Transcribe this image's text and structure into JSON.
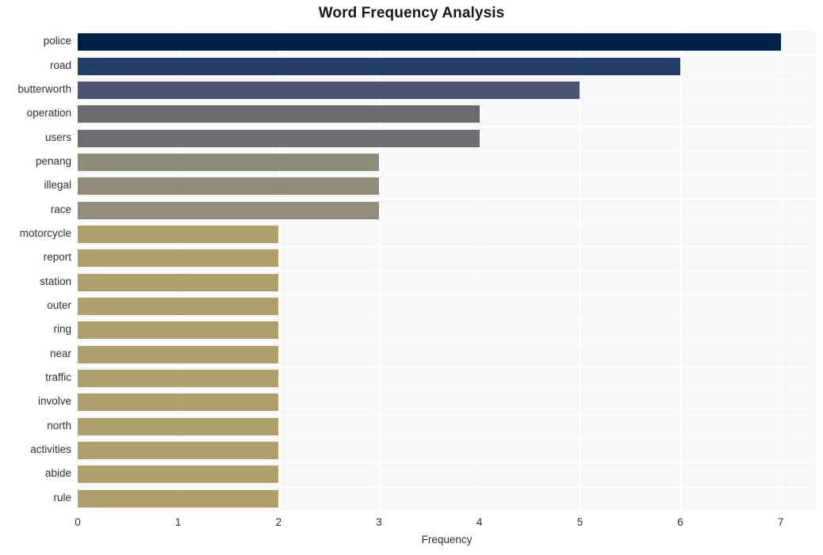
{
  "chart_data": {
    "type": "bar",
    "orientation": "horizontal",
    "title": "Word Frequency Analysis",
    "xlabel": "Frequency",
    "ylabel": "",
    "xlim": [
      0,
      7.35
    ],
    "ylim": [
      0,
      20
    ],
    "grid": true,
    "legend": false,
    "xticks": [
      0,
      1,
      2,
      3,
      4,
      5,
      6,
      7
    ],
    "xtick_labels": [
      "0",
      "1",
      "2",
      "3",
      "4",
      "5",
      "6",
      "7"
    ],
    "categories": [
      "police",
      "road",
      "butterworth",
      "operation",
      "users",
      "penang",
      "illegal",
      "race",
      "motorcycle",
      "report",
      "station",
      "outer",
      "ring",
      "near",
      "traffic",
      "involve",
      "north",
      "activities",
      "abide",
      "rule"
    ],
    "values": [
      7,
      6,
      5,
      4,
      4,
      3,
      3,
      3,
      2,
      2,
      2,
      2,
      2,
      2,
      2,
      2,
      2,
      2,
      2,
      2
    ],
    "bar_colors": [
      "#002147",
      "#253D6B",
      "#4C5470",
      "#6B6C70",
      "#6D6E73",
      "#8F8B79",
      "#918C78",
      "#918D7A",
      "#ADA06C",
      "#ADA06C",
      "#ADA06C",
      "#ADA06C",
      "#ADA06C",
      "#ADA06C",
      "#ADA06C",
      "#ADA06C",
      "#ADA06C",
      "#ADA06C",
      "#ADA06C",
      "#ADA06C"
    ],
    "plot_background": "#F7F7F7",
    "figure_background": "#FFFFFF",
    "gridline_color": "#FFFFFF",
    "text_color": "#2E2E2E"
  }
}
